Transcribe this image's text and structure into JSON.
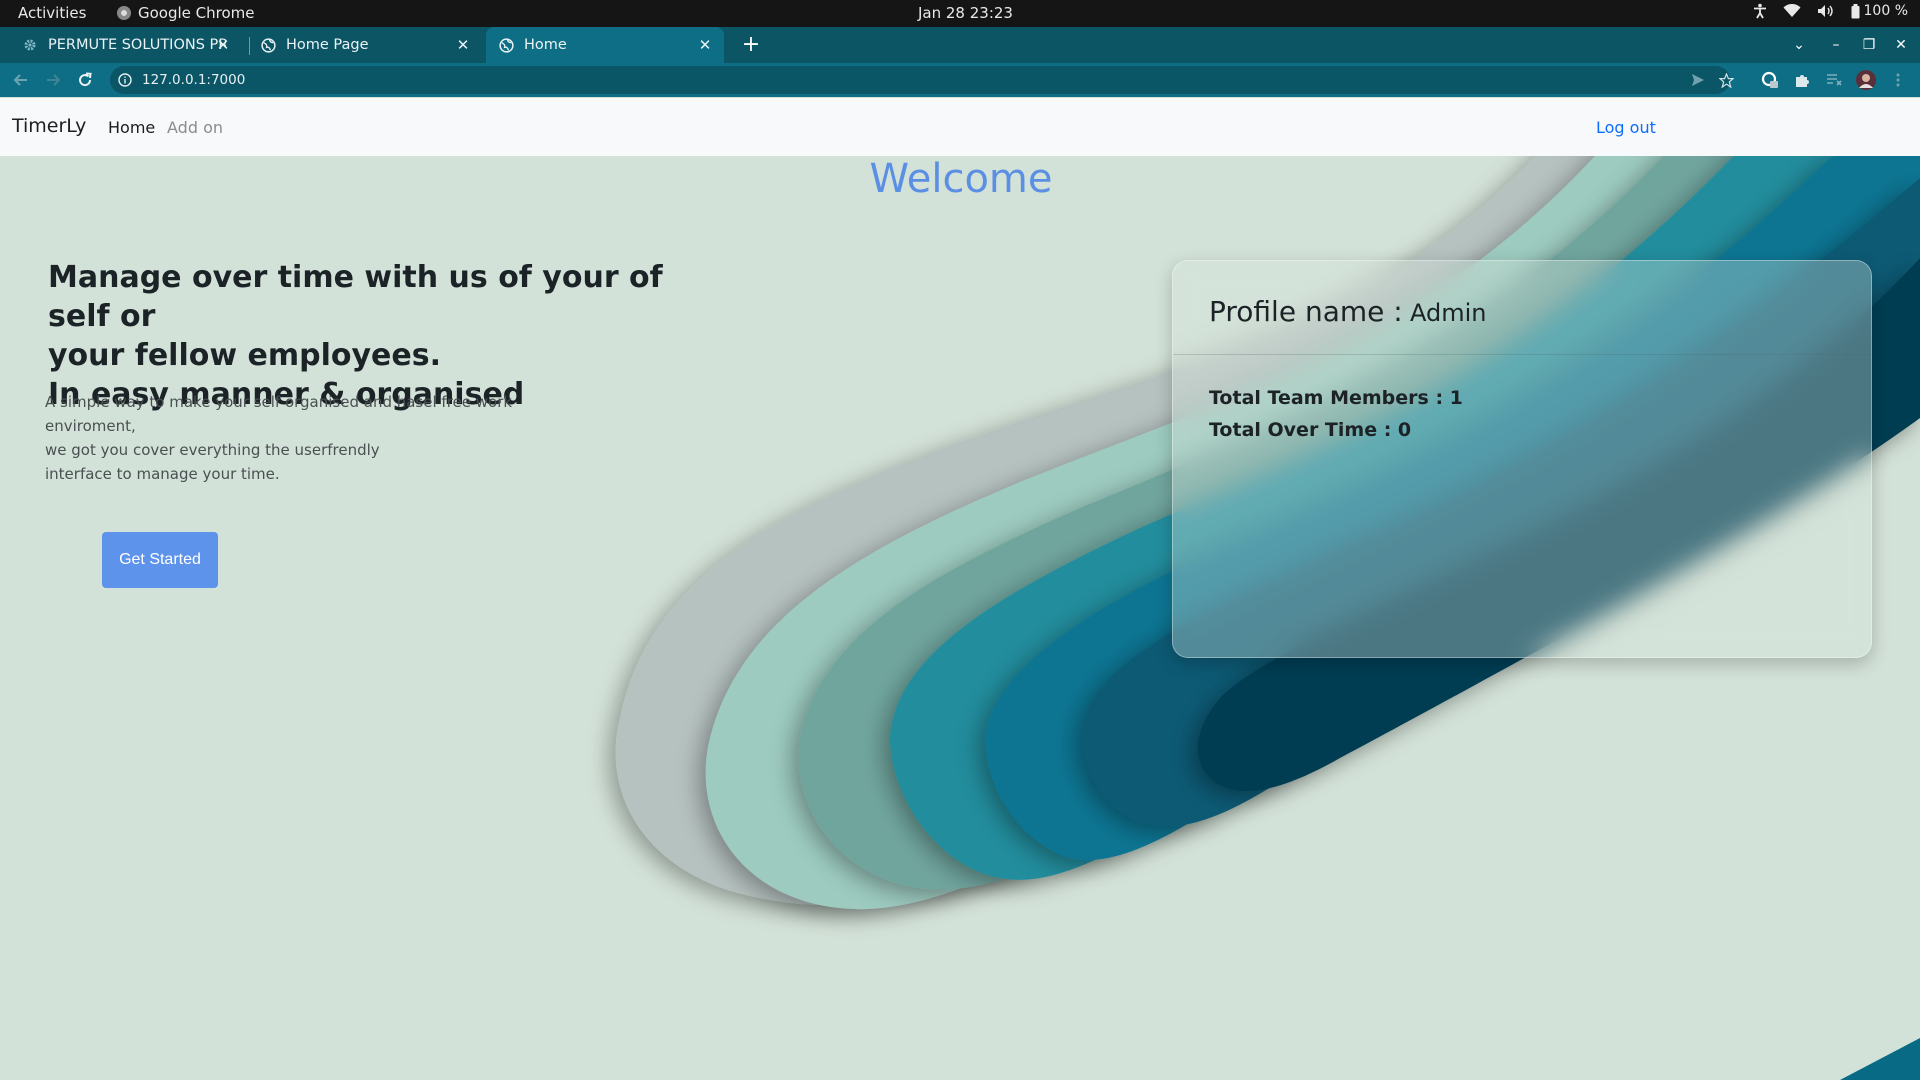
{
  "system_bar": {
    "activities": "Activities",
    "app_name": "Google Chrome",
    "clock": "Jan 28  23:23",
    "battery": "100 %"
  },
  "tabs": [
    {
      "title": "PERMUTE SOLUTIONS PRI",
      "active": false
    },
    {
      "title": "Home Page",
      "active": false
    },
    {
      "title": "Home",
      "active": true
    }
  ],
  "address_bar": {
    "url": "127.0.0.1:7000"
  },
  "navbar": {
    "brand": "TimerLy",
    "links": [
      "Home",
      "Add on"
    ],
    "logout": "Log out"
  },
  "hero": {
    "welcome": "Welcome",
    "headline_lines": [
      "Manage over time with us of your of self or",
      "your fellow employees.",
      "In easy manner & organised"
    ],
    "subtext_lines": [
      "A simple way to make your self organised and hasel free work enviroment,",
      "we got you cover everything the userfrendly",
      "interface to manage your time."
    ],
    "cta_label": "Get Started"
  },
  "profile_card": {
    "label": "Profile name :",
    "name": "Admin",
    "stats": [
      "Total Team Members : 1",
      "Total Over Time : 0"
    ]
  },
  "colors": {
    "accent": "#5e93ec",
    "link": "#0d6efd",
    "chrome_frame": "#0e6e85",
    "page_bg": "#d3e2d8"
  }
}
